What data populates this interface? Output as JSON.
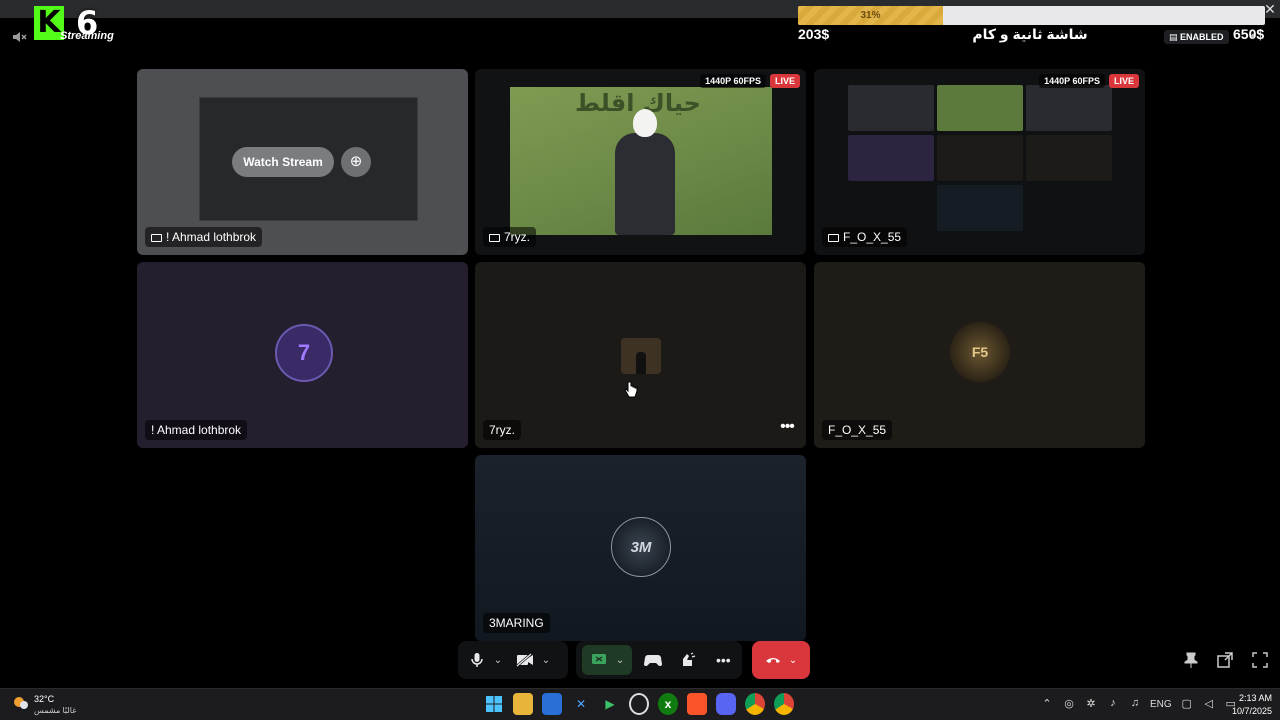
{
  "overlay": {
    "kick_logo": "K",
    "viewer_count": "6",
    "streaming_label": "Streaming"
  },
  "goal": {
    "progress_percent": 31,
    "progress_label": "31%",
    "current_amount": "203$",
    "title": "شاشة ثانية و كام",
    "status_badge": "ENABLED",
    "target_amount": "650$"
  },
  "stream_tiles": [
    {
      "user": "! Ahmad lothbrok",
      "watch_label": "Watch Stream"
    },
    {
      "user": "7ryz.",
      "quality": "1440P 60FPS",
      "live": "LIVE",
      "wall_text": "حياك اقلط"
    },
    {
      "user": "F_O_X_55",
      "quality": "1440P 60FPS",
      "live": "LIVE"
    }
  ],
  "participants": [
    {
      "name": "! Ahmad lothbrok",
      "avatar_text": "7"
    },
    {
      "name": "7ryz."
    },
    {
      "name": "F_O_X_55",
      "avatar_text": "F5"
    },
    {
      "name": "3MARING",
      "avatar_text": "3M"
    }
  ],
  "controls": {
    "mic": "microphone-icon",
    "camera": "camera-off-icon",
    "screen_share": "screen-share-icon",
    "activities": "gamepad-icon",
    "soundboard": "soundboard-icon",
    "more": "more-icon",
    "disconnect": "hang-up-icon"
  },
  "taskbar": {
    "weather_temp": "32°C",
    "weather_desc": "غالبًا مشمس",
    "lang": "ENG",
    "time": "2:13 AM",
    "date": "10/7/2025"
  }
}
